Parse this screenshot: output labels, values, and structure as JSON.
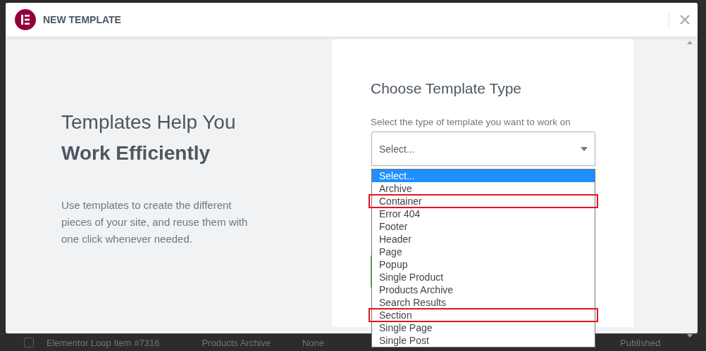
{
  "modal": {
    "title": "NEW TEMPLATE"
  },
  "intro": {
    "heading": "Templates Help You",
    "heading_bold": "Work Efficiently",
    "description": "Use templates to create the different pieces of your site, and reuse them with one click whenever needed."
  },
  "form": {
    "heading": "Choose Template Type",
    "label": "Select the type of template you want to work on",
    "select": {
      "value": "Select...",
      "expanded": true,
      "options": [
        {
          "label": "Select...",
          "selected": true,
          "highlighted": false
        },
        {
          "label": "Archive",
          "selected": false,
          "highlighted": false
        },
        {
          "label": "Container",
          "selected": false,
          "highlighted": true
        },
        {
          "label": "Error 404",
          "selected": false,
          "highlighted": false
        },
        {
          "label": "Footer",
          "selected": false,
          "highlighted": false
        },
        {
          "label": "Header",
          "selected": false,
          "highlighted": false
        },
        {
          "label": "Page",
          "selected": false,
          "highlighted": false
        },
        {
          "label": "Popup",
          "selected": false,
          "highlighted": false
        },
        {
          "label": "Single Product",
          "selected": false,
          "highlighted": false
        },
        {
          "label": "Products Archive",
          "selected": false,
          "highlighted": false
        },
        {
          "label": "Search Results",
          "selected": false,
          "highlighted": false
        },
        {
          "label": "Section",
          "selected": false,
          "highlighted": true
        },
        {
          "label": "Single Page",
          "selected": false,
          "highlighted": false
        },
        {
          "label": "Single Post",
          "selected": false,
          "highlighted": false
        }
      ]
    }
  },
  "background_row": {
    "checked": false,
    "title": "Elementor Loop Item #7316",
    "type": "Products Archive",
    "column_3": "None",
    "status": "Published"
  }
}
